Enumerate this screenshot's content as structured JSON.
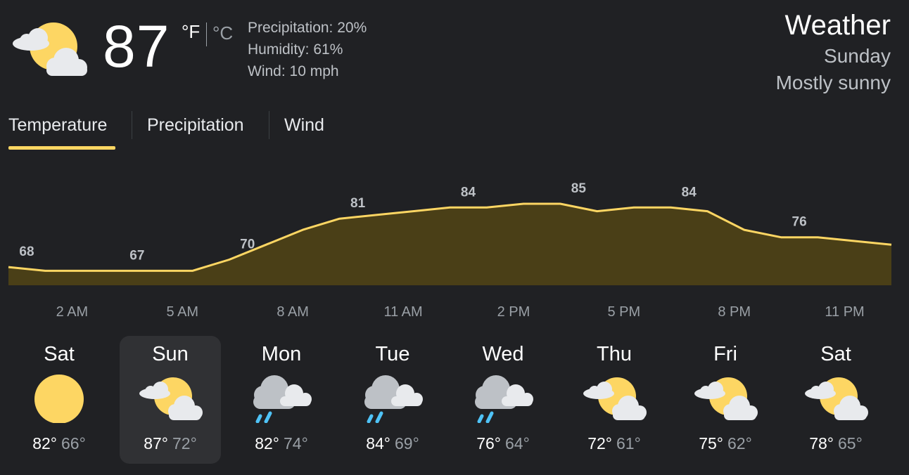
{
  "current": {
    "icon": "partly-cloudy-icon",
    "temperature": "87",
    "unit_f": "°F",
    "unit_c": "°C",
    "precipitation": "Precipitation: 20%",
    "humidity": "Humidity: 61%",
    "wind": "Wind: 10 mph"
  },
  "header": {
    "title": "Weather",
    "day": "Sunday",
    "condition": "Mostly sunny"
  },
  "tabs": [
    {
      "label": "Temperature",
      "selected": true
    },
    {
      "label": "Precipitation",
      "selected": false
    },
    {
      "label": "Wind",
      "selected": false
    }
  ],
  "colors": {
    "accent": "#fdd663",
    "chart_fill": "#4a3f17",
    "background": "#202124"
  },
  "chart_data": {
    "type": "area",
    "x": [
      "2 AM",
      "3 AM",
      "4 AM",
      "5 AM",
      "6 AM",
      "7 AM",
      "8 AM",
      "9 AM",
      "10 AM",
      "11 AM",
      "12 PM",
      "1 PM",
      "2 PM",
      "3 PM",
      "4 PM",
      "5 PM",
      "6 PM",
      "7 PM",
      "8 PM",
      "9 PM",
      "10 PM",
      "11 PM",
      "12 AM",
      "1 AM",
      "2 AM"
    ],
    "values": [
      68,
      67,
      67,
      67,
      67,
      67,
      70,
      74,
      78,
      81,
      82,
      83,
      84,
      84,
      85,
      85,
      83,
      84,
      84,
      83,
      78,
      76,
      76,
      75,
      74
    ],
    "labeled_points": [
      {
        "index": 0,
        "label": "68"
      },
      {
        "index": 3,
        "label": "67"
      },
      {
        "index": 6,
        "label": "70"
      },
      {
        "index": 9,
        "label": "81"
      },
      {
        "index": 12,
        "label": "84"
      },
      {
        "index": 15,
        "label": "85"
      },
      {
        "index": 18,
        "label": "84"
      },
      {
        "index": 21,
        "label": "76"
      }
    ],
    "tick_labels": [
      {
        "index": 1.5,
        "label": "2 AM"
      },
      {
        "index": 4.5,
        "label": "5 AM"
      },
      {
        "index": 7.5,
        "label": "8 AM"
      },
      {
        "index": 10.5,
        "label": "11 AM"
      },
      {
        "index": 13.5,
        "label": "2 PM"
      },
      {
        "index": 16.5,
        "label": "5 PM"
      },
      {
        "index": 19.5,
        "label": "8 PM"
      },
      {
        "index": 22.5,
        "label": "11 PM"
      }
    ],
    "ylim": [
      54,
      90
    ]
  },
  "days": [
    {
      "name": "Sat",
      "icon": "sunny-icon",
      "high": "82°",
      "low": "66°",
      "selected": false
    },
    {
      "name": "Sun",
      "icon": "partly-cloudy-icon",
      "high": "87°",
      "low": "72°",
      "selected": true
    },
    {
      "name": "Mon",
      "icon": "rain-icon",
      "high": "82°",
      "low": "74°",
      "selected": false
    },
    {
      "name": "Tue",
      "icon": "rain-icon",
      "high": "84°",
      "low": "69°",
      "selected": false
    },
    {
      "name": "Wed",
      "icon": "rain-icon",
      "high": "76°",
      "low": "64°",
      "selected": false
    },
    {
      "name": "Thu",
      "icon": "partly-cloudy-icon",
      "high": "72°",
      "low": "61°",
      "selected": false
    },
    {
      "name": "Fri",
      "icon": "partly-cloudy-icon",
      "high": "75°",
      "low": "62°",
      "selected": false
    },
    {
      "name": "Sat",
      "icon": "partly-cloudy-icon",
      "high": "78°",
      "low": "65°",
      "selected": false
    }
  ]
}
